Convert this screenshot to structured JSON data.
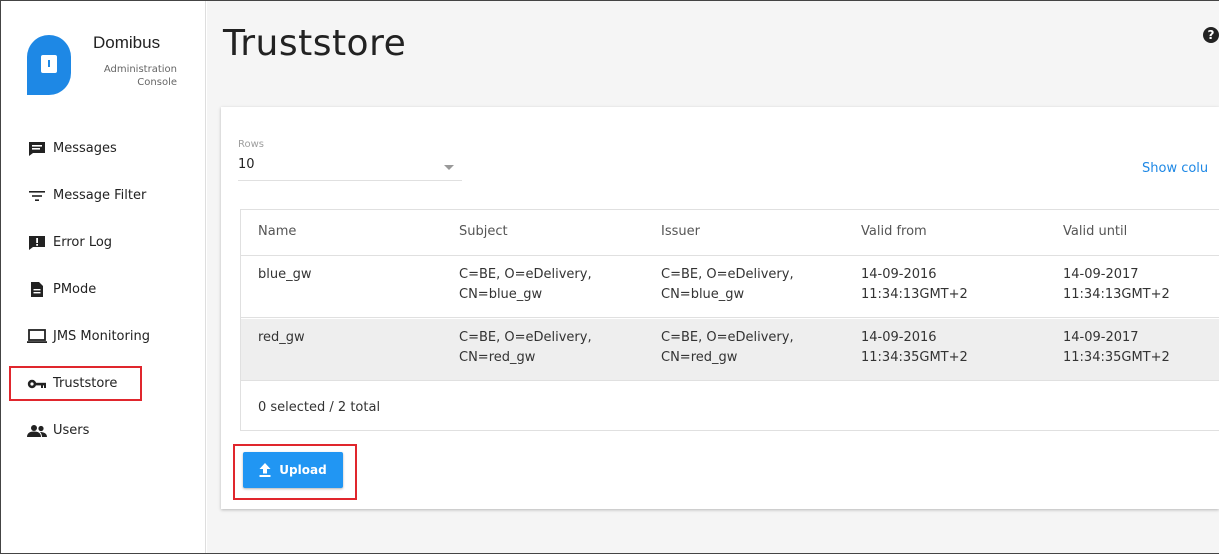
{
  "brand": {
    "title": "Domibus",
    "subtitle_line1": "Administration",
    "subtitle_line2": "Console",
    "color": "#1e88e5"
  },
  "sidebar": {
    "items": [
      {
        "label": "Messages",
        "icon": "message-icon"
      },
      {
        "label": "Message Filter",
        "icon": "filter-icon"
      },
      {
        "label": "Error Log",
        "icon": "error-log-icon"
      },
      {
        "label": "PMode",
        "icon": "file-icon"
      },
      {
        "label": "JMS Monitoring",
        "icon": "monitor-icon"
      },
      {
        "label": "Truststore",
        "icon": "key-icon",
        "active": true
      },
      {
        "label": "Users",
        "icon": "users-icon"
      }
    ]
  },
  "page": {
    "title": "Truststore",
    "help_icon": "?"
  },
  "controls": {
    "rows_label": "Rows",
    "rows_value": "10",
    "show_columns": "Show colu"
  },
  "table": {
    "columns": [
      "Name",
      "Subject",
      "Issuer",
      "Valid from",
      "Valid until"
    ],
    "rows": [
      {
        "name": "blue_gw",
        "subject_1": "C=BE, O=eDelivery,",
        "subject_2": "CN=blue_gw",
        "issuer_1": "C=BE, O=eDelivery,",
        "issuer_2": "CN=blue_gw",
        "from_1": "14-09-2016",
        "from_2": "11:34:13GMT+2",
        "until_1": "14-09-2017",
        "until_2": "11:34:13GMT+2"
      },
      {
        "name": "red_gw",
        "subject_1": "C=BE, O=eDelivery,",
        "subject_2": "CN=red_gw",
        "issuer_1": "C=BE, O=eDelivery,",
        "issuer_2": "CN=red_gw",
        "from_1": "14-09-2016",
        "from_2": "11:34:35GMT+2",
        "until_1": "14-09-2017",
        "until_2": "11:34:35GMT+2"
      }
    ],
    "footer": "0 selected / 2 total"
  },
  "actions": {
    "upload_label": "Upload",
    "upload_color": "#2196f3"
  },
  "highlight_color": "#e0262d"
}
